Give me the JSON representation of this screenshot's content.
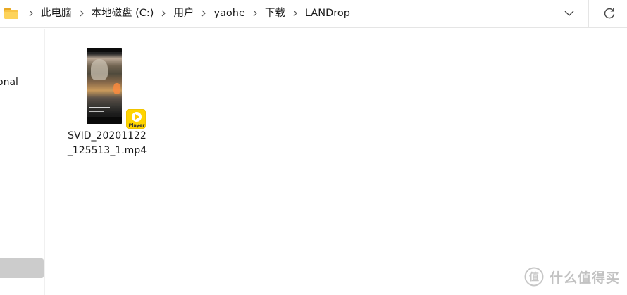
{
  "breadcrumb": {
    "items": [
      "此电脑",
      "本地磁盘 (C:)",
      "用户",
      "yaohe",
      "下载",
      "LANDrop"
    ]
  },
  "nav": {
    "partial_item_label": "onal"
  },
  "files": [
    {
      "name_line1": "SVID_20201122",
      "name_line2": "_125513_1.mp4",
      "badge_label": "Player"
    }
  ],
  "watermark": {
    "text": "什么值得买"
  },
  "icons": {
    "folder": "folder-icon",
    "separator": "chevron-right-icon",
    "dropdown": "chevron-down-icon",
    "refresh": "refresh-icon",
    "badge": "play-icon",
    "watermark": "smzdm-logo-icon"
  },
  "colors": {
    "folder": "#f8c445",
    "badge": "#ffd400",
    "selection": "#cccccc"
  }
}
